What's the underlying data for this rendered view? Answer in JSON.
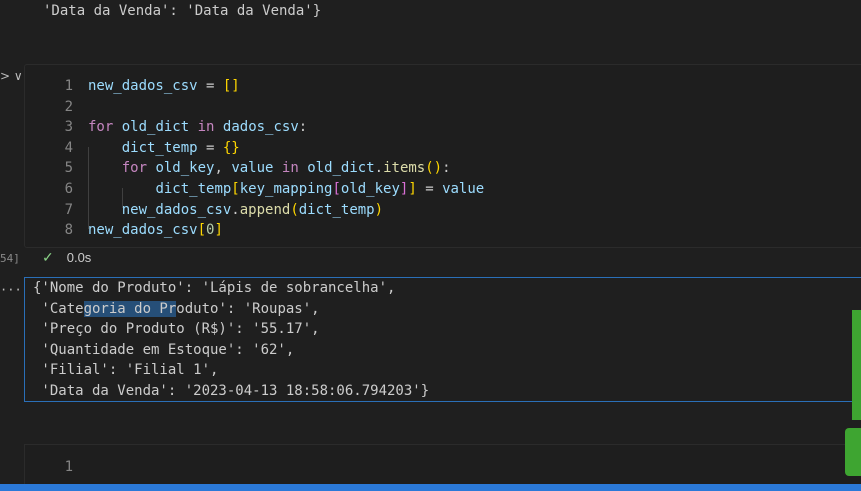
{
  "previous_output": "'Data da Venda': 'Data da Venda'}",
  "left_margin": {
    "collapse": "> ∨",
    "exec_count": "54]",
    "output_menu": "···"
  },
  "code_cell": {
    "line_numbers": [
      "1",
      "2",
      "3",
      "4",
      "5",
      "6",
      "7",
      "8"
    ],
    "lines": [
      [
        {
          "t": "new_dados_csv",
          "c": "var"
        },
        {
          "t": " = ",
          "c": ""
        },
        {
          "t": "[]",
          "c": "br1"
        }
      ],
      [],
      [
        {
          "t": "for",
          "c": "kw"
        },
        {
          "t": " ",
          "c": ""
        },
        {
          "t": "old_dict",
          "c": "var"
        },
        {
          "t": " ",
          "c": ""
        },
        {
          "t": "in",
          "c": "kw"
        },
        {
          "t": " ",
          "c": ""
        },
        {
          "t": "dados_csv",
          "c": "var"
        },
        {
          "t": ":",
          "c": ""
        }
      ],
      [
        {
          "t": "    ",
          "c": ""
        },
        {
          "t": "dict_temp",
          "c": "var"
        },
        {
          "t": " = ",
          "c": ""
        },
        {
          "t": "{}",
          "c": "br1"
        }
      ],
      [
        {
          "t": "    ",
          "c": ""
        },
        {
          "t": "for",
          "c": "kw"
        },
        {
          "t": " ",
          "c": ""
        },
        {
          "t": "old_key",
          "c": "var"
        },
        {
          "t": ", ",
          "c": ""
        },
        {
          "t": "value",
          "c": "var"
        },
        {
          "t": " ",
          "c": ""
        },
        {
          "t": "in",
          "c": "kw"
        },
        {
          "t": " ",
          "c": ""
        },
        {
          "t": "old_dict",
          "c": "var"
        },
        {
          "t": ".",
          "c": ""
        },
        {
          "t": "items",
          "c": "fn"
        },
        {
          "t": "()",
          "c": "br1"
        },
        {
          "t": ":",
          "c": ""
        }
      ],
      [
        {
          "t": "        ",
          "c": ""
        },
        {
          "t": "dict_temp",
          "c": "var"
        },
        {
          "t": "[",
          "c": "br1"
        },
        {
          "t": "key_mapping",
          "c": "var"
        },
        {
          "t": "[",
          "c": "br2"
        },
        {
          "t": "old_key",
          "c": "var"
        },
        {
          "t": "]",
          "c": "br2"
        },
        {
          "t": "]",
          "c": "br1"
        },
        {
          "t": " = ",
          "c": ""
        },
        {
          "t": "value",
          "c": "var"
        }
      ],
      [
        {
          "t": "    ",
          "c": ""
        },
        {
          "t": "new_dados_csv",
          "c": "var"
        },
        {
          "t": ".",
          "c": ""
        },
        {
          "t": "append",
          "c": "fn"
        },
        {
          "t": "(",
          "c": "br1"
        },
        {
          "t": "dict_temp",
          "c": "var"
        },
        {
          "t": ")",
          "c": "br1"
        }
      ],
      [
        {
          "t": "new_dados_csv",
          "c": "var"
        },
        {
          "t": "[",
          "c": "br1"
        },
        {
          "t": "0",
          "c": "num"
        },
        {
          "t": "]",
          "c": "br1"
        }
      ]
    ]
  },
  "execution": {
    "check": "✓",
    "time": "0.0s"
  },
  "output": {
    "lines": [
      [
        {
          "t": "{'Nome do Produto': 'Lápis de sobrancelha',",
          "s": false
        }
      ],
      [
        {
          "t": " 'Cate",
          "s": false
        },
        {
          "t": "goria do Pr",
          "s": true
        },
        {
          "t": "oduto': 'Roupas',",
          "s": false
        }
      ],
      [
        {
          "t": " 'Preço do Produto (R$)': '55.17',",
          "s": false
        }
      ],
      [
        {
          "t": " 'Quantidade em Estoque': '62',",
          "s": false
        }
      ],
      [
        {
          "t": " 'Filial': 'Filial 1',",
          "s": false
        }
      ],
      [
        {
          "t": " 'Data da Venda': '2023-04-13 18:58:06.794203'}",
          "s": false
        }
      ]
    ]
  },
  "next_cell": {
    "line_number": "1"
  },
  "colors": {
    "background": "#1f1f1f",
    "keyword": "#c586c0",
    "variable": "#9cdcfe",
    "function": "#dcdcaa",
    "bracket_level1": "#ffd700",
    "bracket_level2": "#da70d6",
    "number": "#b5cea8",
    "selection": "#264f78",
    "output_border": "#2a6fb8",
    "success_check": "#89d185",
    "status_bar": "#2b79d8"
  }
}
